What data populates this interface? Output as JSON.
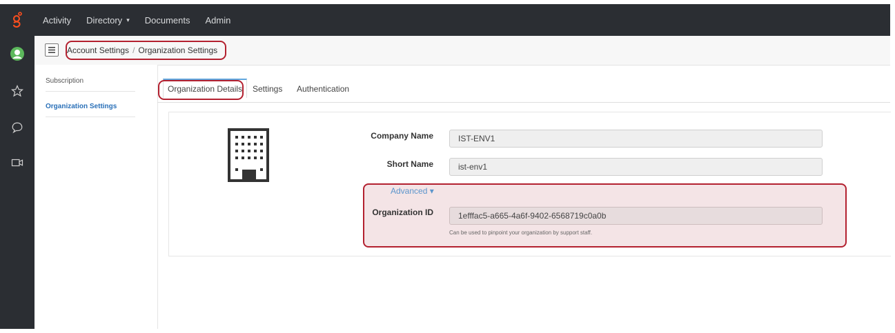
{
  "topnav": {
    "items": [
      {
        "label": "Activity"
      },
      {
        "label": "Directory"
      },
      {
        "label": "Documents"
      },
      {
        "label": "Admin"
      }
    ],
    "directory_caret": "▾"
  },
  "rail": {
    "icons": [
      "avatar",
      "star-icon",
      "chat-icon",
      "video-icon"
    ]
  },
  "breadcrumb": {
    "parent": "Account Settings",
    "separator": "/",
    "current": "Organization Settings"
  },
  "sidebar": {
    "items": [
      {
        "label": "Subscription"
      },
      {
        "label": "Organization Settings"
      }
    ]
  },
  "tabs": [
    {
      "label": "Organization Details"
    },
    {
      "label": "Settings"
    },
    {
      "label": "Authentication"
    }
  ],
  "form": {
    "company_name_label": "Company Name",
    "company_name_value": "IST-ENV1",
    "short_name_label": "Short Name",
    "short_name_value": "ist-env1",
    "advanced_label": "Advanced ▾",
    "org_id_label": "Organization ID",
    "org_id_value": "1efffac5-a665-4a6f-9402-6568719c0a0b",
    "org_id_help": "Can be used to pinpoint your organization by support staff."
  },
  "colors": {
    "topbar": "#2b2e33",
    "accent_blue": "#2a70b8",
    "highlight_red": "#b3202f",
    "brand_orange": "#ff4f1f"
  }
}
